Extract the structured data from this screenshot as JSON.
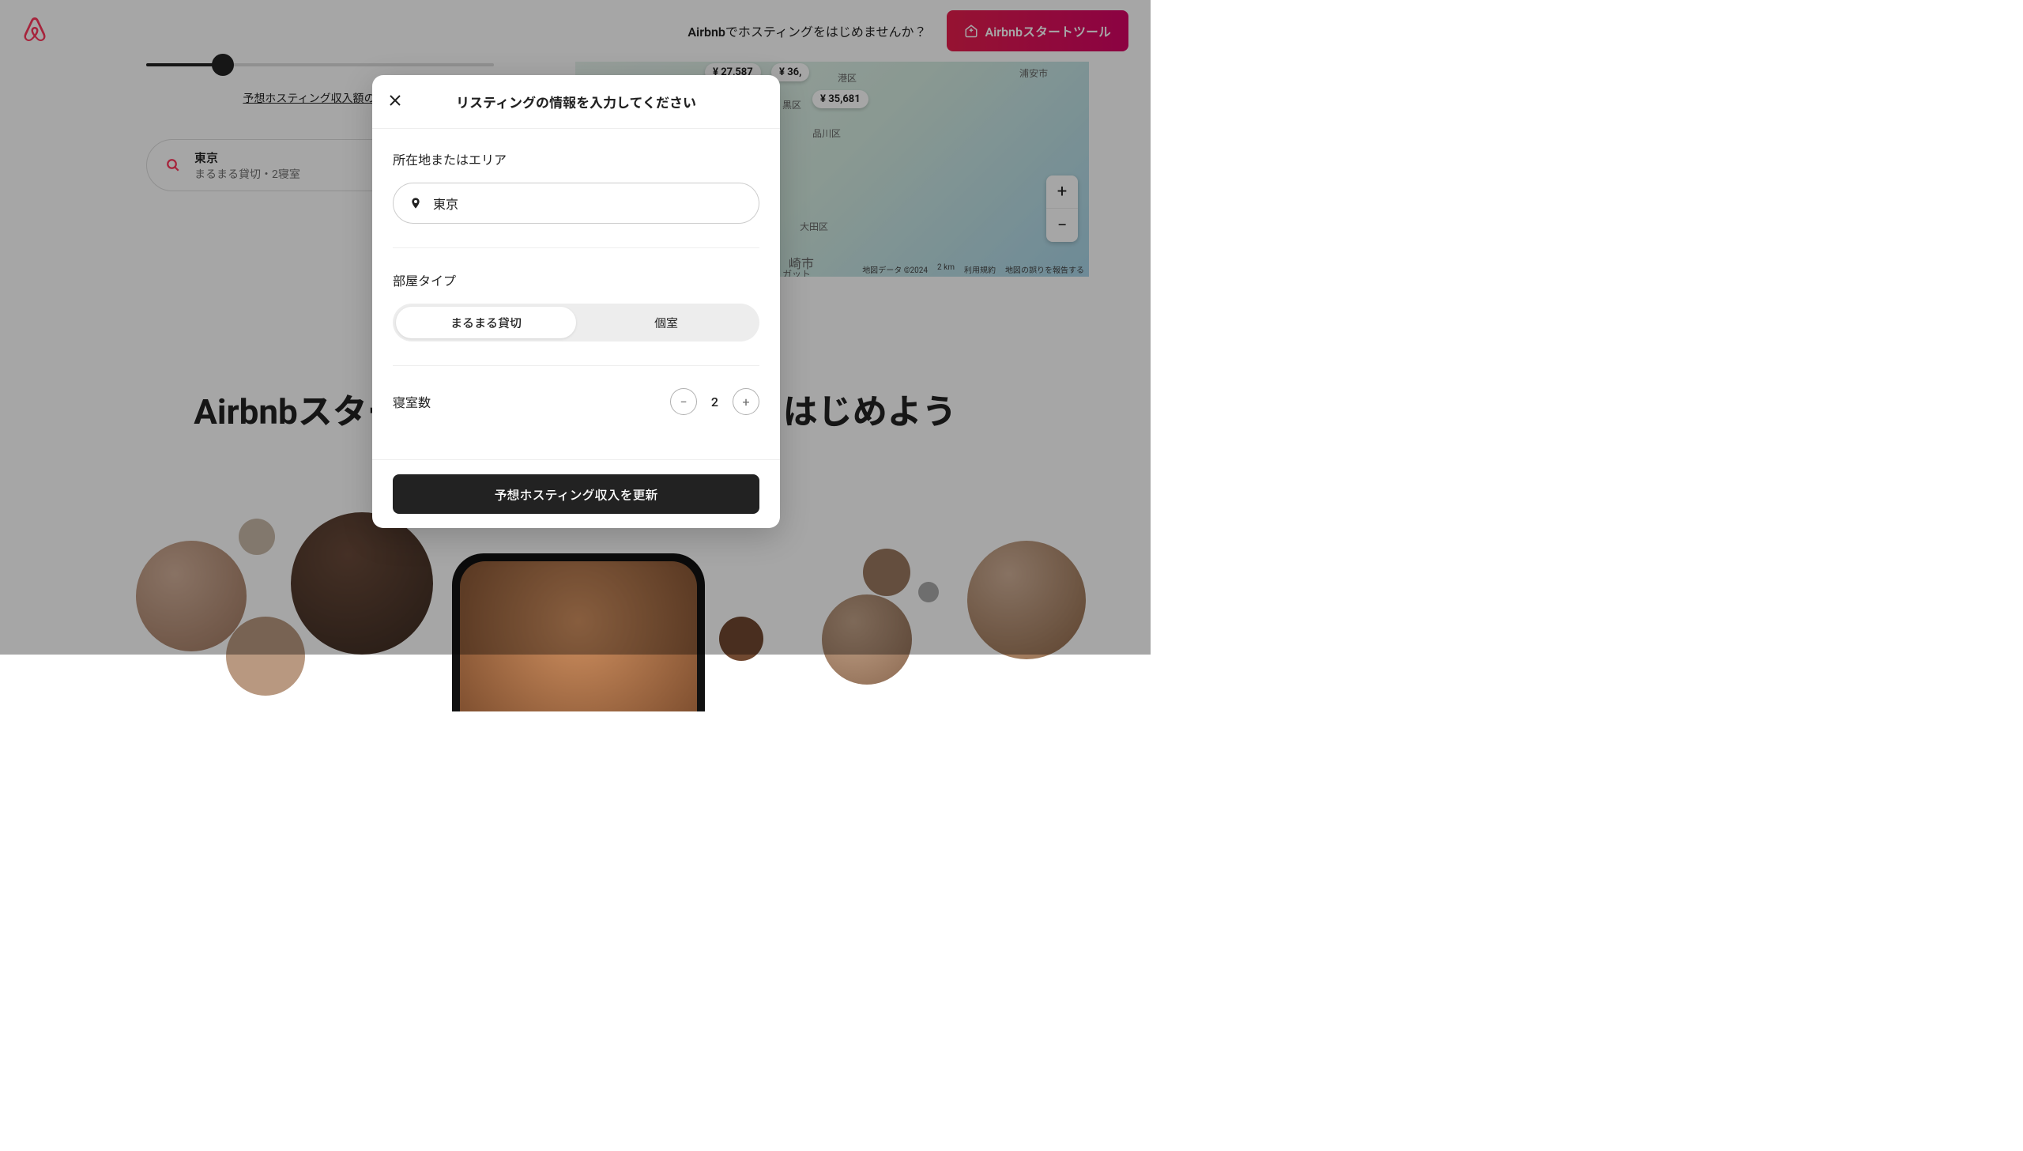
{
  "header": {
    "prompt_brand": "Airbnb",
    "prompt_rest": "でホスティングをはじめませんか？",
    "cta": "Airbnbスタートツール"
  },
  "slider": {
    "calc_link": "予想ホスティング収入額の計算"
  },
  "search": {
    "line1": "東京",
    "line2": "まるまる貸切・2寝室"
  },
  "map": {
    "pins": [
      "¥ 27,587",
      "¥ 36,",
      "¥ 35,681"
    ],
    "labels": {
      "minato": "港区",
      "shinagawa": "品川区",
      "ota": "大田区",
      "urayasu": "浦安市",
      "ku": "黒区",
      "gatto": "ガット",
      "saki": "崎市"
    },
    "attribution": {
      "data": "地図データ ©2024",
      "scale": "2 km",
      "terms": "利用規約",
      "report": "地図の誤りを報告する"
    }
  },
  "hero": {
    "title": "Airbnbスタート                                グをはじめよう"
  },
  "modal": {
    "title": "リスティングの情報を入力してください",
    "loc_label": "所在地またはエリア",
    "loc_value": "東京",
    "room_label": "部屋タイプ",
    "room_options": {
      "entire": "まるまる貸切",
      "private": "個室"
    },
    "bed_label": "寝室数",
    "bed_value": "2",
    "submit": "予想ホスティング収入を更新"
  }
}
